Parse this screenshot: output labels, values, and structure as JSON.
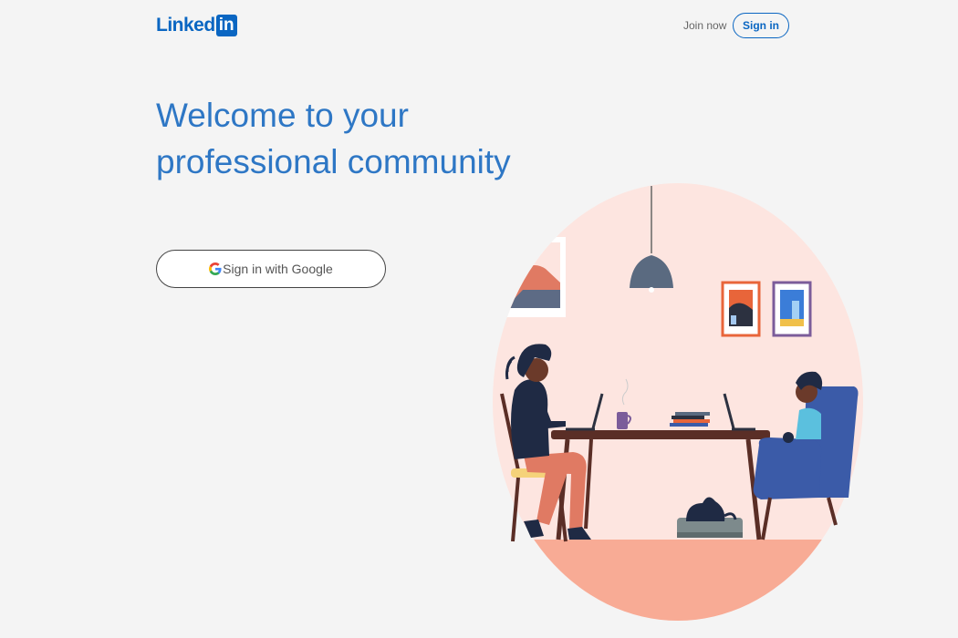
{
  "header": {
    "logo_text": "Linked",
    "logo_box": "in",
    "join_now": "Join now",
    "sign_in": "Sign in"
  },
  "hero": {
    "headline_line1": "Welcome to your",
    "headline_line2": "professional community"
  },
  "google_button": {
    "icon": "google-g-icon",
    "label": "Sign in with Google"
  },
  "colors": {
    "brand": "#0a66c2",
    "headline": "#2e77c5",
    "background": "#f4f4f4",
    "illustration_circle": "#fde5e0",
    "illustration_floor": "#f8ab95"
  }
}
